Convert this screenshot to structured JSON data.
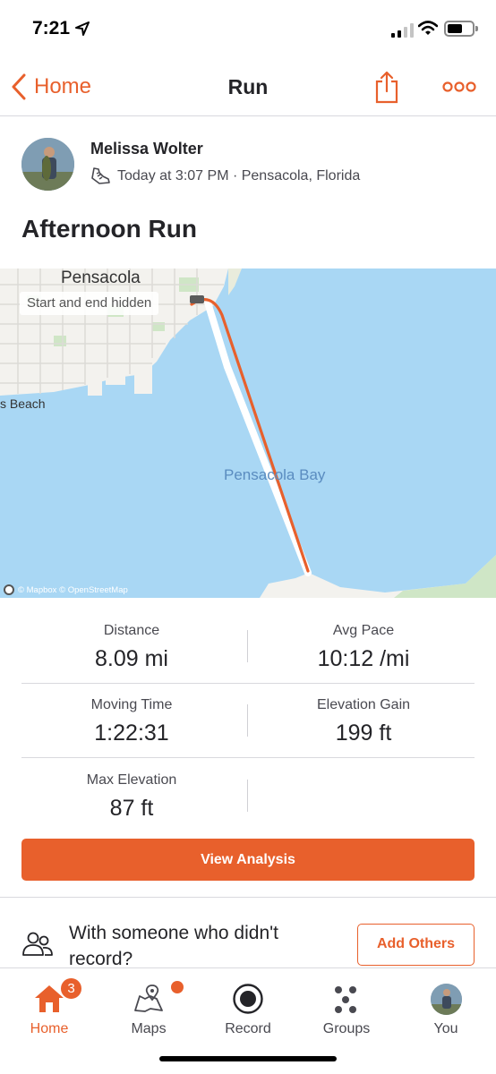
{
  "status": {
    "time": "7:21",
    "location_icon": "location-arrow-icon",
    "signal_icon": "signal-icon",
    "wifi_icon": "wifi-icon",
    "battery_icon": "battery-icon"
  },
  "nav": {
    "back_label": "Home",
    "title": "Run",
    "share_icon": "share-icon",
    "more_icon": "more-icon"
  },
  "activity": {
    "athlete_name": "Melissa Wolter",
    "meta": "Today at 3:07 PM · Pensacola, Florida",
    "sport_icon": "running-shoe-icon",
    "title": "Afternoon Run"
  },
  "map": {
    "city_label": "Pensacola",
    "privacy_label": "Start and end hidden",
    "beach_label": "s Beach",
    "bay_label": "Pensacola Bay",
    "attribution": "© Mapbox © OpenStreetMap",
    "route_color": "#e8602c",
    "water_color": "#a9d7f4"
  },
  "stats": [
    {
      "label": "Distance",
      "value": "8.09 mi"
    },
    {
      "label": "Avg Pace",
      "value": "10:12 /mi"
    },
    {
      "label": "Moving Time",
      "value": "1:22:31"
    },
    {
      "label": "Elevation Gain",
      "value": "199 ft"
    },
    {
      "label": "Max Elevation",
      "value": "87 ft"
    }
  ],
  "actions": {
    "view_analysis": "View Analysis",
    "others_prompt": "With someone who didn't record?",
    "add_others": "Add Others"
  },
  "tabs": [
    {
      "label": "Home",
      "icon": "home-icon",
      "badge": "3",
      "active": true
    },
    {
      "label": "Maps",
      "icon": "maps-icon"
    },
    {
      "label": "Record",
      "icon": "record-icon"
    },
    {
      "label": "Groups",
      "icon": "groups-icon"
    },
    {
      "label": "You",
      "icon": "avatar"
    }
  ],
  "colors": {
    "accent": "#e8602c",
    "text": "#242428"
  }
}
